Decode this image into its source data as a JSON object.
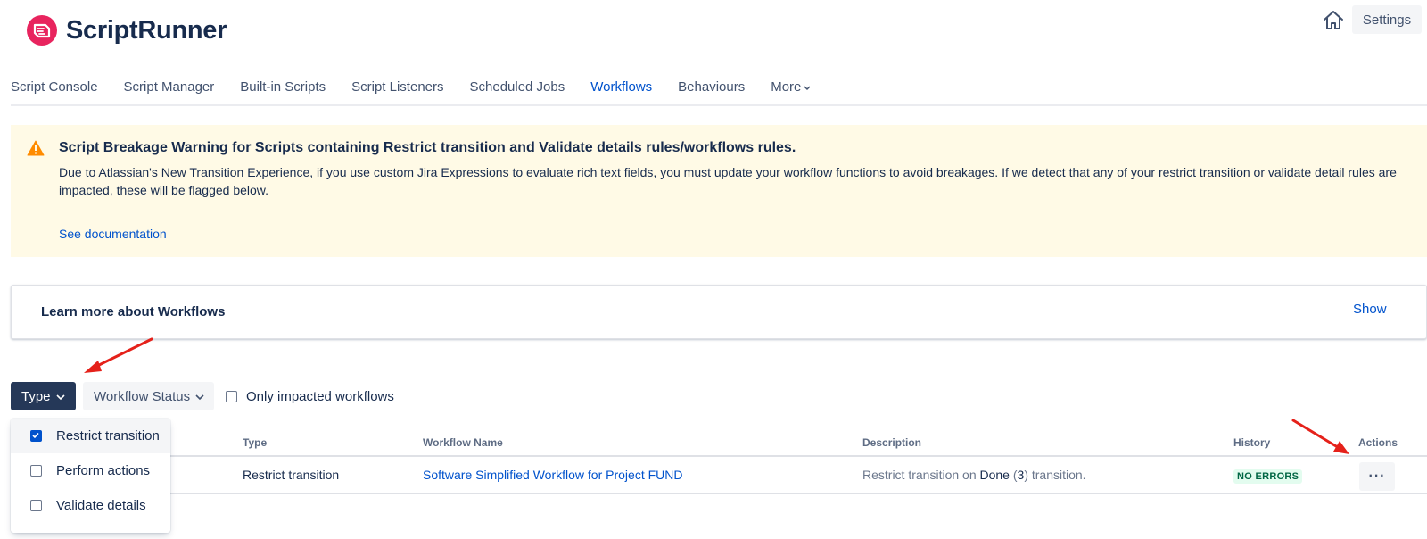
{
  "app": {
    "name": "ScriptRunner",
    "brand_color": "#e8245e"
  },
  "header": {
    "settings_label": "Settings",
    "home_icon": "home-icon"
  },
  "nav": {
    "items": [
      {
        "label": "Script Console"
      },
      {
        "label": "Script Manager"
      },
      {
        "label": "Built-in Scripts"
      },
      {
        "label": "Script Listeners"
      },
      {
        "label": "Scheduled Jobs"
      },
      {
        "label": "Workflows",
        "active": true
      },
      {
        "label": "Behaviours"
      },
      {
        "label": "More"
      }
    ]
  },
  "warning": {
    "title": "Script Breakage Warning for Scripts containing Restrict transition and Validate details rules/workflows rules.",
    "body": "Due to Atlassian's New Transition Experience, if you use custom Jira Expressions to evaluate rich text fields, you must update your workflow functions to avoid breakages. If we detect that any of your restrict transition or validate detail rules are impacted, these will be flagged below.",
    "link": "See documentation",
    "icon": "warning-icon",
    "color": "#fffae6"
  },
  "learn": {
    "title": "Learn more about Workflows",
    "action": "Show"
  },
  "filters": {
    "type_label": "Type",
    "status_label": "Workflow Status",
    "impacted_label": "Only impacted workflows",
    "impacted_checked": false,
    "type_options": [
      {
        "label": "Restrict transition",
        "checked": true
      },
      {
        "label": "Perform actions",
        "checked": false
      },
      {
        "label": "Validate details",
        "checked": false
      }
    ]
  },
  "table": {
    "headers": {
      "type": "Type",
      "workflow": "Workflow Name",
      "description": "Description",
      "history": "History",
      "actions": "Actions"
    },
    "rows": [
      {
        "type": "Restrict transition",
        "workflow": "Software Simplified Workflow for Project FUND",
        "desc_prefix": "Restrict transition on ",
        "desc_status": "Done",
        "desc_open": " (",
        "desc_id": "3",
        "desc_suffix": ") transition.",
        "history": "NO ERRORS",
        "actions": "···"
      }
    ]
  }
}
